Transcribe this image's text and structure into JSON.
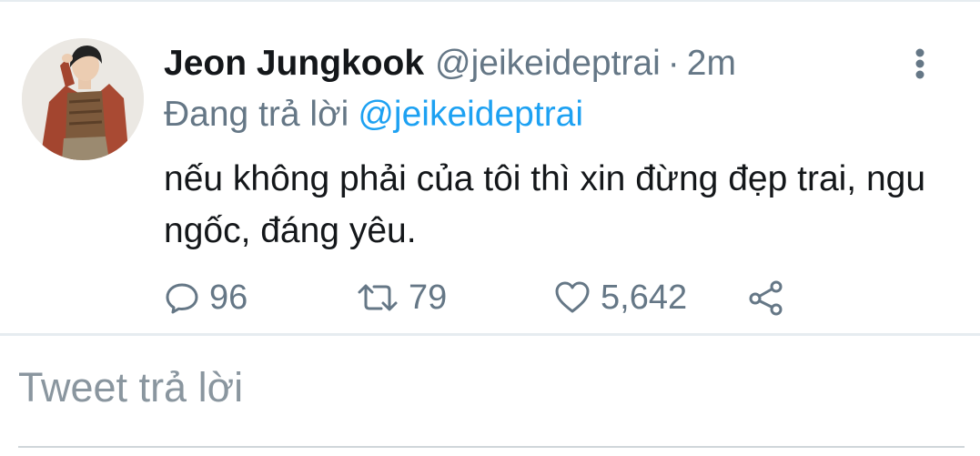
{
  "tweet": {
    "author_name": "Jeon Jungkook",
    "handle": "@jeikeideptrai",
    "separator": "·",
    "time": "2m",
    "replying_label": "Đang trả lời",
    "replying_to": "@jeikeideptrai",
    "text": "nếu không phải của tôi thì xin đừng đẹp trai, ngu ngốc, đáng yêu.",
    "more_icon": "more-vertical-icon",
    "avatar": "user-avatar-photo"
  },
  "actions": {
    "replies": {
      "icon": "reply-icon",
      "count": "96"
    },
    "retweets": {
      "icon": "retweet-icon",
      "count": "79"
    },
    "likes": {
      "icon": "heart-icon",
      "count": "5,642"
    },
    "share": {
      "icon": "share-icon"
    }
  },
  "composer": {
    "placeholder": "Tweet trả lời"
  },
  "colors": {
    "text_primary": "#14171a",
    "text_secondary": "#657786",
    "accent": "#1da1f2",
    "divider": "#e6ecf0"
  }
}
